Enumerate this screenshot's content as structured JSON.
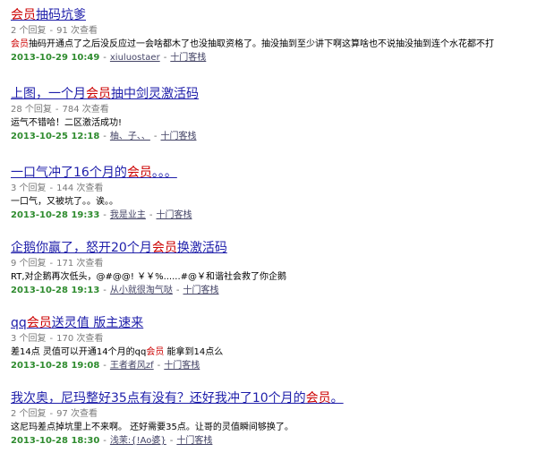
{
  "results": [
    {
      "title": [
        {
          "t": "会员",
          "hl": true
        },
        {
          "t": "抽码坑爹",
          "hl": false
        }
      ],
      "replies": "2 个回复",
      "views": "91 次查看",
      "snippet": [
        {
          "t": "会员",
          "hl": true
        },
        {
          "t": "抽码开通点了之后没反应过一会啥都木了也没抽取资格了。抽没抽到至少讲下啊这算啥也不说抽没抽到连个水花都不打",
          "hl": false
        }
      ],
      "date": "2013-10-29 10:49",
      "author": "xiuluostaer",
      "forum": "十门客栈"
    },
    {
      "title": [
        {
          "t": "上图，一个月",
          "hl": false
        },
        {
          "t": "会员",
          "hl": true
        },
        {
          "t": "抽中剑灵激活码",
          "hl": false
        }
      ],
      "replies": "28 个回复",
      "views": "784 次查看",
      "snippet": [
        {
          "t": "运气不错哈！二区激活成功!",
          "hl": false
        }
      ],
      "date": "2013-10-25 12:18",
      "author": "柚、子、、",
      "forum": "十门客栈"
    },
    {
      "title": [
        {
          "t": "一口气冲了16个月的",
          "hl": false
        },
        {
          "t": "会员",
          "hl": true
        },
        {
          "t": "。。。",
          "hl": false
        }
      ],
      "replies": "3 个回复",
      "views": "144 次查看",
      "snippet": [
        {
          "t": "一口气，又被坑了。。诶。。",
          "hl": false
        }
      ],
      "date": "2013-10-28 19:33",
      "author": "我是业主",
      "forum": "十门客栈"
    },
    {
      "title": [
        {
          "t": "企鹅你赢了，怒开20个月",
          "hl": false
        },
        {
          "t": "会员",
          "hl": true
        },
        {
          "t": "换激活码",
          "hl": false
        }
      ],
      "replies": "9 个回复",
      "views": "171 次查看",
      "snippet": [
        {
          "t": "RT,对企鹅再次低头，@#@@! ￥￥%......#@￥和谐社会救了你企鹅",
          "hl": false
        }
      ],
      "date": "2013-10-28 19:13",
      "author": "从小就很淘气哒",
      "forum": "十门客栈"
    },
    {
      "title": [
        {
          "t": "qq",
          "hl": false
        },
        {
          "t": "会员",
          "hl": true
        },
        {
          "t": "送灵值 版主速来",
          "hl": false
        }
      ],
      "replies": "3 个回复",
      "views": "170 次查看",
      "snippet": [
        {
          "t": "差14点 灵值可以开通14个月的qq",
          "hl": false
        },
        {
          "t": "会员",
          "hl": true
        },
        {
          "t": " 能拿到14点么",
          "hl": false
        }
      ],
      "date": "2013-10-28 19:08",
      "author": "王者者风zf",
      "forum": "十门客栈"
    },
    {
      "title": [
        {
          "t": "我次奥，尼玛整好35点有没有？还好我冲了10个月的",
          "hl": false
        },
        {
          "t": "会员",
          "hl": true
        },
        {
          "t": "。",
          "hl": false
        }
      ],
      "replies": "2 个回复",
      "views": "97 次查看",
      "snippet": [
        {
          "t": "这尼玛差点掉坑里上不来啊。 还好需要35点。让哥的灵值瞬间够换了。",
          "hl": false
        }
      ],
      "date": "2013-10-28 18:30",
      "author": "浅茉:{!Ao婆}",
      "forum": "十门客栈"
    }
  ],
  "separator": "-",
  "colors": {
    "title": "#1e1eaa",
    "highlight": "#cc0000",
    "date": "#2e8b2e",
    "meta": "#7a7a7a"
  }
}
